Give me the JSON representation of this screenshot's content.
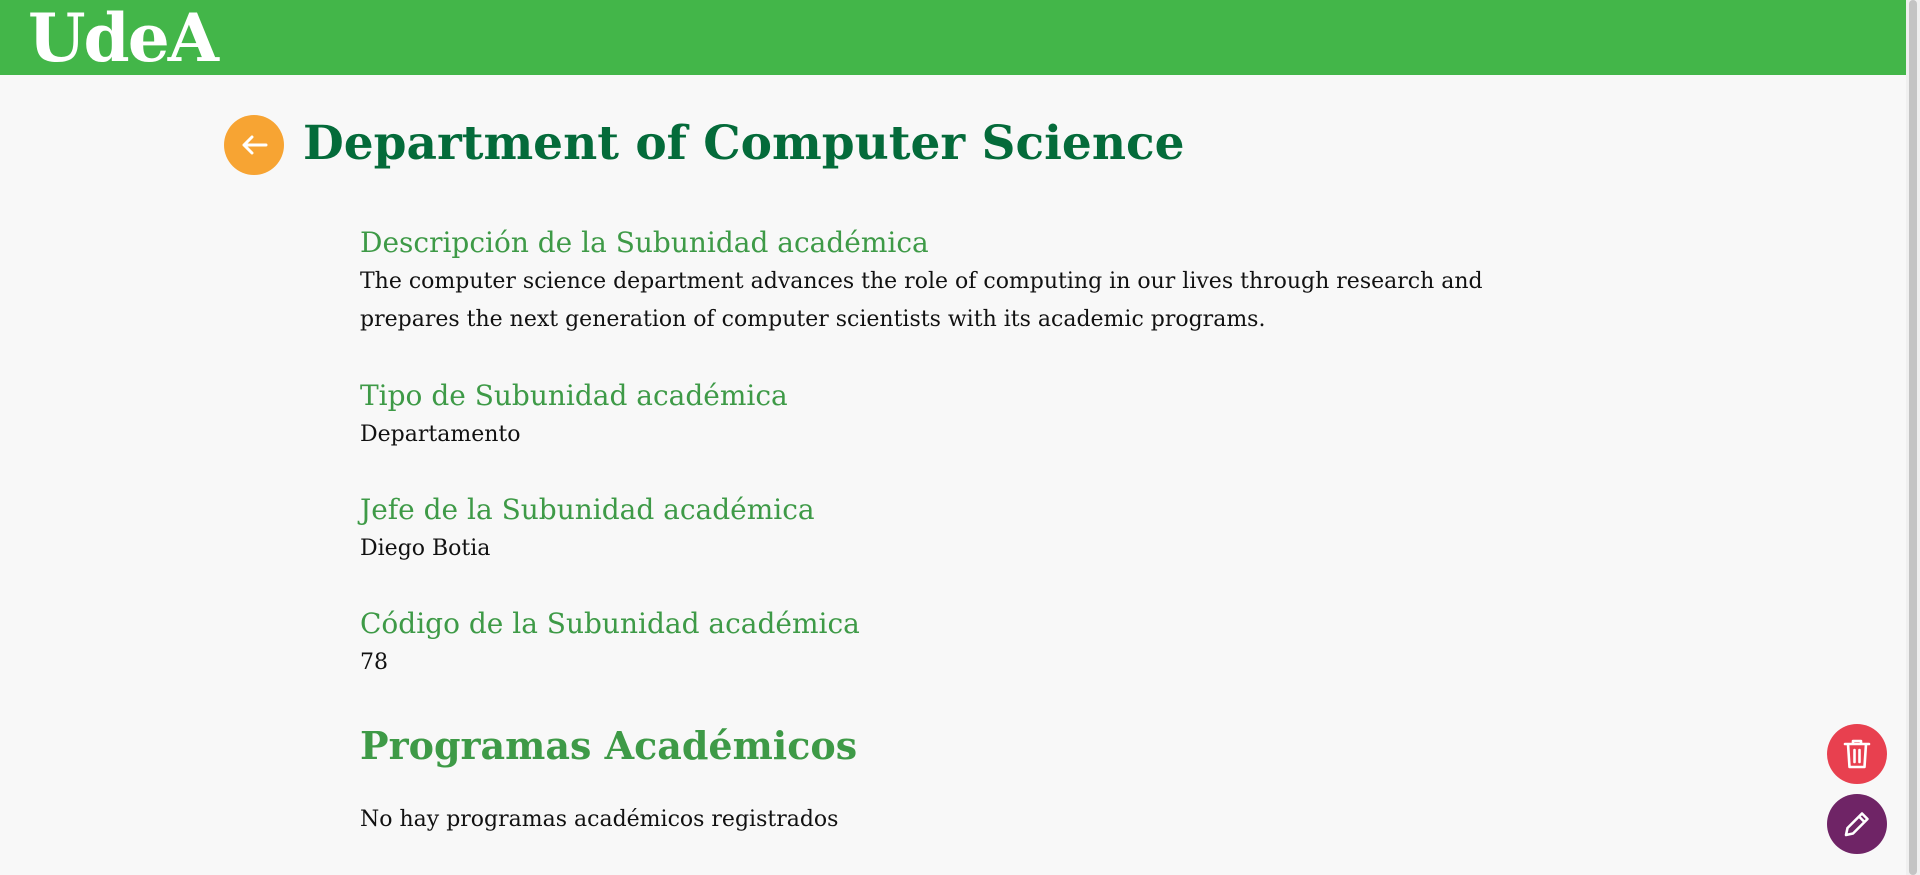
{
  "header": {
    "logo_text": "UdeA",
    "brand_color": "#43b649"
  },
  "page": {
    "title": "Department of Computer Science",
    "back_icon": "arrow-left-icon"
  },
  "fields": {
    "description": {
      "label": "Descripción de la Subunidad académica",
      "value": "The computer science department advances the role of computing in our lives through research and prepares the next generation of computer scientists with its academic programs."
    },
    "type": {
      "label": "Tipo de Subunidad académica",
      "value": "Departamento"
    },
    "head": {
      "label": "Jefe de la Subunidad académica",
      "value": "Diego Botia"
    },
    "code": {
      "label": "Código de la Subunidad académica",
      "value": "78"
    }
  },
  "programs": {
    "title": "Programas Académicos",
    "empty_message": "No hay programas académicos registrados"
  },
  "actions": {
    "delete_icon": "trash-icon",
    "edit_icon": "pencil-icon",
    "delete_color": "#e8404f",
    "edit_color": "#6f2466",
    "back_color": "#f7a433"
  }
}
